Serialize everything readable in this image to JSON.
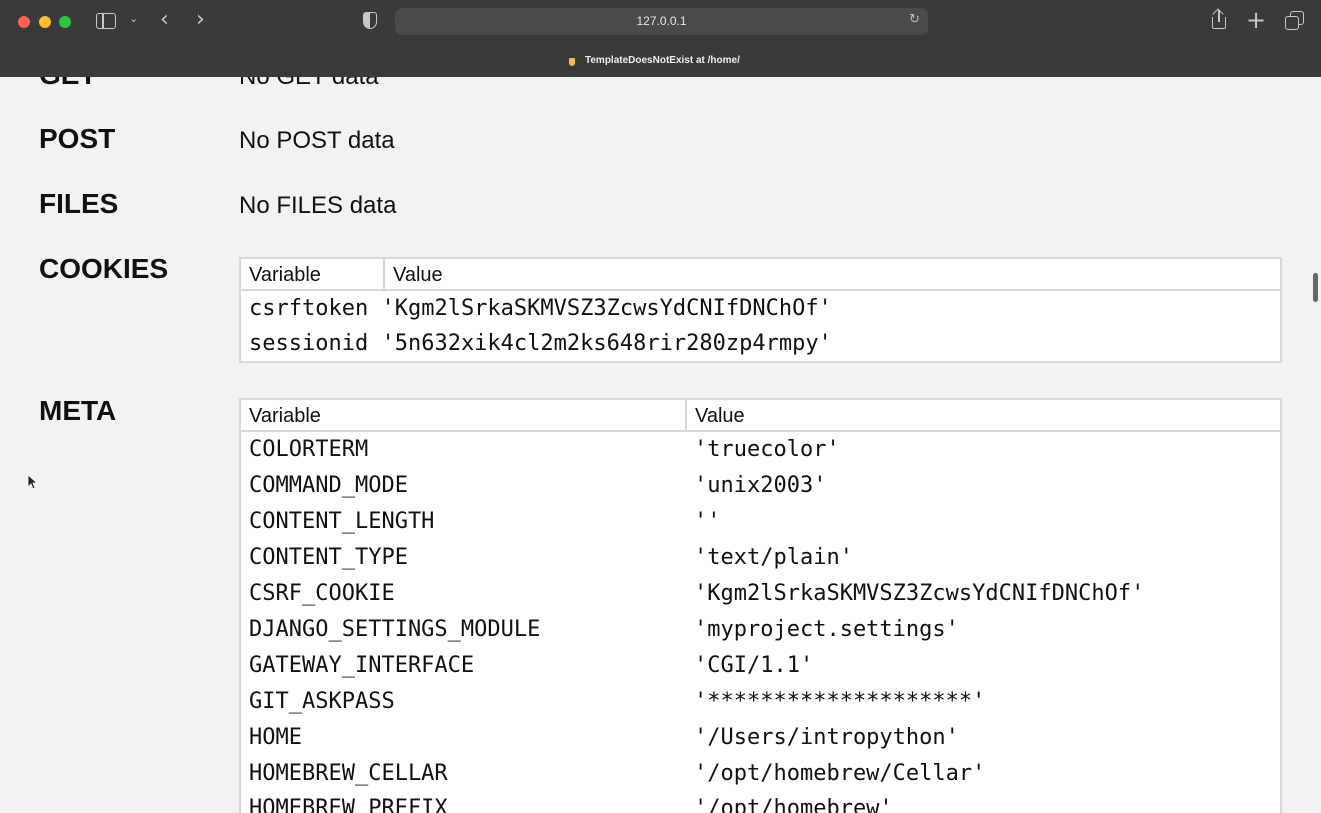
{
  "browser": {
    "url": "127.0.0.1",
    "tab_title": "TemplateDoesNotExist at /home/"
  },
  "sections": {
    "get": {
      "label": "GET",
      "value": "No GET data"
    },
    "post": {
      "label": "POST",
      "value": "No POST data"
    },
    "files": {
      "label": "FILES",
      "value": "No FILES data"
    },
    "cookies": {
      "label": "COOKIES",
      "headers": [
        "Variable",
        "Value"
      ],
      "rows": [
        [
          "csrftoken",
          "'Kgm2lSrkaSKMVSZ3ZcwsYdCNIfDNChOf'"
        ],
        [
          "sessionid",
          "'5n632xik4cl2m2ks648rir280zp4rmpy'"
        ]
      ]
    },
    "meta": {
      "label": "META",
      "headers": [
        "Variable",
        "Value"
      ],
      "rows": [
        [
          "COLORTERM",
          "'truecolor'"
        ],
        [
          "COMMAND_MODE",
          "'unix2003'"
        ],
        [
          "CONTENT_LENGTH",
          "''"
        ],
        [
          "CONTENT_TYPE",
          "'text/plain'"
        ],
        [
          "CSRF_COOKIE",
          "'Kgm2lSrkaSKMVSZ3ZcwsYdCNIfDNChOf'"
        ],
        [
          "DJANGO_SETTINGS_MODULE",
          "'myproject.settings'"
        ],
        [
          "GATEWAY_INTERFACE",
          "'CGI/1.1'"
        ],
        [
          "GIT_ASKPASS",
          "'********************'"
        ],
        [
          "HOME",
          "'/Users/intropython'"
        ],
        [
          "HOMEBREW_CELLAR",
          "'/opt/homebrew/Cellar'"
        ],
        [
          "HOMEBREW_PREFIX",
          "'/opt/homebrew'"
        ]
      ]
    }
  }
}
